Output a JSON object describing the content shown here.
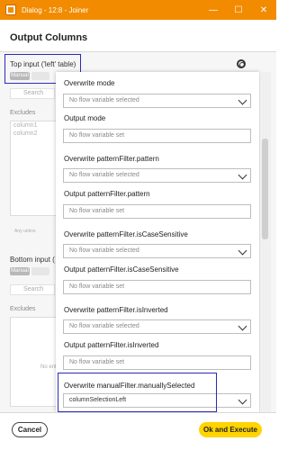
{
  "window": {
    "title": "Dialog - 12:8 - Joiner",
    "minimize_glyph": "—",
    "maximize_glyph": "☐",
    "close_glyph": "✕"
  },
  "header": {
    "title": "Output Columns"
  },
  "background": {
    "top_input_label": "Top input ('left' table)",
    "manual_label": "Manual",
    "search_placeholder": "Search",
    "excludes_label": "Excludes",
    "exclude_items": [
      "column1",
      "column2"
    ],
    "any_unknown_label": "Any unkno",
    "bottom_input_label": "Bottom input (",
    "manual_label_2": "Manual",
    "search_placeholder_2": "Search",
    "excludes_label_2": "Excludes",
    "no_entries_label": "No ent"
  },
  "flow_variables": {
    "overwrite_mode_label": "Overwrite mode",
    "overwrite_mode_value": "No flow variable selected",
    "output_mode_label": "Output mode",
    "output_mode_value": "No flow variable set",
    "overwrite_pattern_label": "Overwrite patternFilter.pattern",
    "overwrite_pattern_value": "No flow variable selected",
    "output_pattern_label": "Output patternFilter.pattern",
    "output_pattern_value": "No flow variable set",
    "overwrite_case_label": "Overwrite patternFilter.isCaseSensitive",
    "overwrite_case_value": "No flow variable selected",
    "output_case_label": "Output patternFilter.isCaseSensitive",
    "output_case_value": "No flow variable set",
    "overwrite_inverted_label": "Overwrite patternFilter.isInverted",
    "overwrite_inverted_value": "No flow variable selected",
    "output_inverted_label": "Output patternFilter.isInverted",
    "output_inverted_value": "No flow variable set",
    "overwrite_manual_label": "Overwrite manualFilter.manuallySelected",
    "overwrite_manual_value": "columnSelectionLeft"
  },
  "footer": {
    "cancel_label": "Cancel",
    "ok_label": "Ok and Execute"
  },
  "colors": {
    "titlebar": "#f28b00",
    "primary_button": "#ffd400",
    "focus_outline": "#2b2bb8"
  }
}
